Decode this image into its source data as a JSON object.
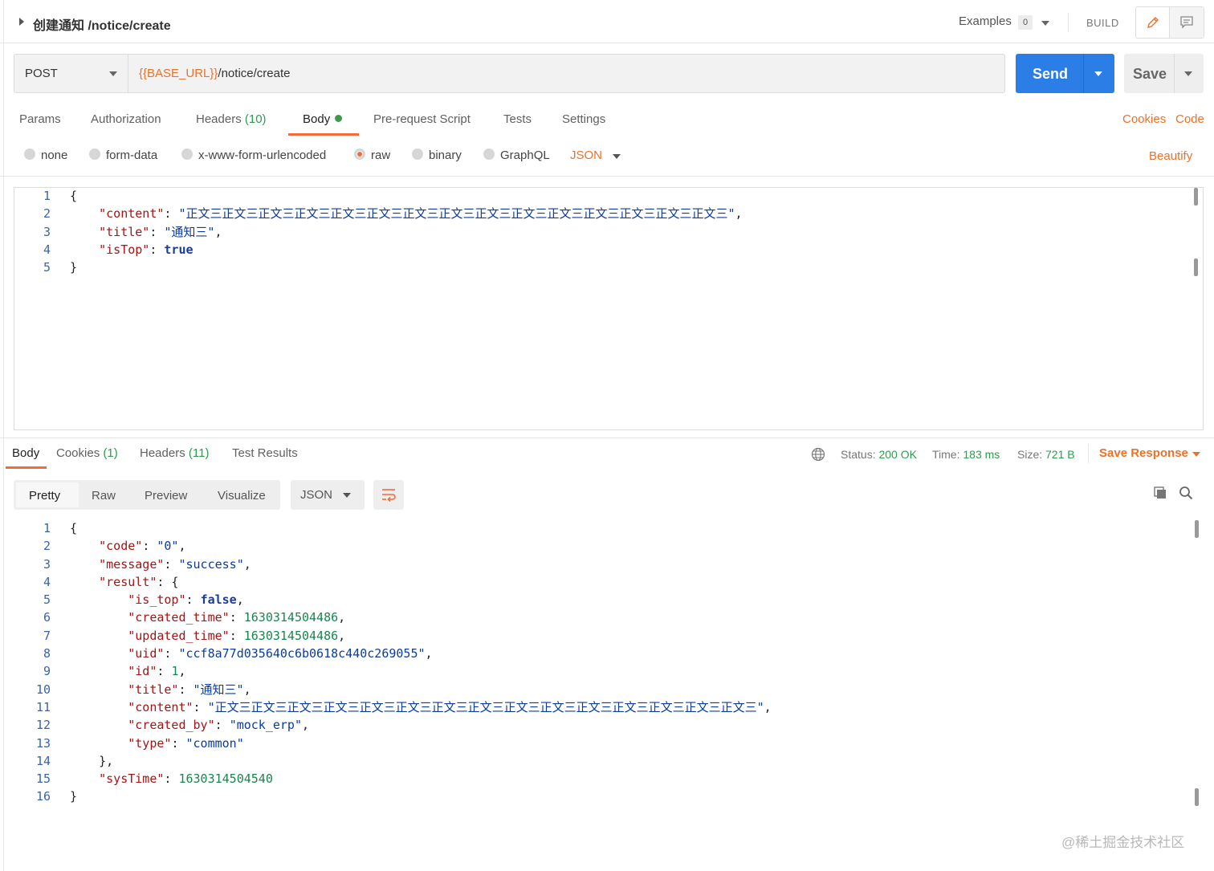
{
  "header": {
    "title": "创建通知 /notice/create",
    "examples_label": "Examples",
    "examples_count": "0",
    "build_label": "BUILD"
  },
  "request": {
    "method": "POST",
    "url_variable": "{{BASE_URL}}",
    "url_path": "/notice/create",
    "send_label": "Send",
    "save_label": "Save"
  },
  "tabs": {
    "params": "Params",
    "authorization": "Authorization",
    "headers": "Headers",
    "headers_count": "(10)",
    "body": "Body",
    "prerequest": "Pre-request Script",
    "tests": "Tests",
    "settings": "Settings",
    "cookies": "Cookies",
    "code": "Code"
  },
  "body_types": {
    "none": "none",
    "form_data": "form-data",
    "urlencoded": "x-www-form-urlencoded",
    "raw": "raw",
    "binary": "binary",
    "graphql": "GraphQL",
    "format": "JSON",
    "beautify": "Beautify"
  },
  "request_body": {
    "line_numbers": [
      "1",
      "2",
      "3",
      "4",
      "5"
    ],
    "lines": [
      [
        [
          "p",
          "{"
        ]
      ],
      [
        [
          "p",
          "    "
        ],
        [
          "k",
          "\"content\""
        ],
        [
          "p",
          ": "
        ],
        [
          "s",
          "\"正文三正文三正文三正文三正文三正文三正文三正文三正文三正文三正文三正文三正文三正文三正文三\""
        ],
        [
          "p",
          ","
        ]
      ],
      [
        [
          "p",
          "    "
        ],
        [
          "k",
          "\"title\""
        ],
        [
          "p",
          ": "
        ],
        [
          "s",
          "\"通知三\""
        ],
        [
          "p",
          ","
        ]
      ],
      [
        [
          "p",
          "    "
        ],
        [
          "k",
          "\"isTop\""
        ],
        [
          "p",
          ": "
        ],
        [
          "b",
          "true"
        ]
      ],
      [
        [
          "p",
          "}"
        ]
      ]
    ]
  },
  "response_tabs": {
    "body": "Body",
    "cookies": "Cookies",
    "cookies_count": "(1)",
    "headers": "Headers",
    "headers_count": "(11)",
    "test_results": "Test Results"
  },
  "response_status": {
    "status_label": "Status:",
    "status_value": "200 OK",
    "time_label": "Time:",
    "time_value": "183 ms",
    "size_label": "Size:",
    "size_value": "721 B",
    "save_response": "Save Response"
  },
  "view_modes": {
    "pretty": "Pretty",
    "raw": "Raw",
    "preview": "Preview",
    "visualize": "Visualize",
    "format": "JSON"
  },
  "response_body": {
    "line_numbers": [
      "1",
      "2",
      "3",
      "4",
      "5",
      "6",
      "7",
      "8",
      "9",
      "10",
      "11",
      "12",
      "13",
      "14",
      "15",
      "16"
    ],
    "lines": [
      [
        [
          "p",
          "{"
        ]
      ],
      [
        [
          "p",
          "    "
        ],
        [
          "k",
          "\"code\""
        ],
        [
          "p",
          ": "
        ],
        [
          "s",
          "\"0\""
        ],
        [
          "p",
          ","
        ]
      ],
      [
        [
          "p",
          "    "
        ],
        [
          "k",
          "\"message\""
        ],
        [
          "p",
          ": "
        ],
        [
          "s",
          "\"success\""
        ],
        [
          "p",
          ","
        ]
      ],
      [
        [
          "p",
          "    "
        ],
        [
          "k",
          "\"result\""
        ],
        [
          "p",
          ": {"
        ]
      ],
      [
        [
          "p",
          "        "
        ],
        [
          "k",
          "\"is_top\""
        ],
        [
          "p",
          ": "
        ],
        [
          "b",
          "false"
        ],
        [
          "p",
          ","
        ]
      ],
      [
        [
          "p",
          "        "
        ],
        [
          "k",
          "\"created_time\""
        ],
        [
          "p",
          ": "
        ],
        [
          "n",
          "1630314504486"
        ],
        [
          "p",
          ","
        ]
      ],
      [
        [
          "p",
          "        "
        ],
        [
          "k",
          "\"updated_time\""
        ],
        [
          "p",
          ": "
        ],
        [
          "n",
          "1630314504486"
        ],
        [
          "p",
          ","
        ]
      ],
      [
        [
          "p",
          "        "
        ],
        [
          "k",
          "\"uid\""
        ],
        [
          "p",
          ": "
        ],
        [
          "s",
          "\"ccf8a77d035640c6b0618c440c269055\""
        ],
        [
          "p",
          ","
        ]
      ],
      [
        [
          "p",
          "        "
        ],
        [
          "k",
          "\"id\""
        ],
        [
          "p",
          ": "
        ],
        [
          "n",
          "1"
        ],
        [
          "p",
          ","
        ]
      ],
      [
        [
          "p",
          "        "
        ],
        [
          "k",
          "\"title\""
        ],
        [
          "p",
          ": "
        ],
        [
          "s",
          "\"通知三\""
        ],
        [
          "p",
          ","
        ]
      ],
      [
        [
          "p",
          "        "
        ],
        [
          "k",
          "\"content\""
        ],
        [
          "p",
          ": "
        ],
        [
          "s",
          "\"正文三正文三正文三正文三正文三正文三正文三正文三正文三正文三正文三正文三正文三正文三正文三\""
        ],
        [
          "p",
          ","
        ]
      ],
      [
        [
          "p",
          "        "
        ],
        [
          "k",
          "\"created_by\""
        ],
        [
          "p",
          ": "
        ],
        [
          "s",
          "\"mock_erp\""
        ],
        [
          "p",
          ","
        ]
      ],
      [
        [
          "p",
          "        "
        ],
        [
          "k",
          "\"type\""
        ],
        [
          "p",
          ": "
        ],
        [
          "s",
          "\"common\""
        ]
      ],
      [
        [
          "p",
          "    },"
        ]
      ],
      [
        [
          "p",
          "    "
        ],
        [
          "k",
          "\"sysTime\""
        ],
        [
          "p",
          ": "
        ],
        [
          "n",
          "1630314504540"
        ]
      ],
      [
        [
          "p",
          "}"
        ]
      ]
    ]
  },
  "watermark": "@稀土掘金技术社区",
  "colors": {
    "accent": "#f26b3a",
    "send": "#2a7ee6",
    "success": "#2e9a4f",
    "variable": "#e8722a"
  }
}
